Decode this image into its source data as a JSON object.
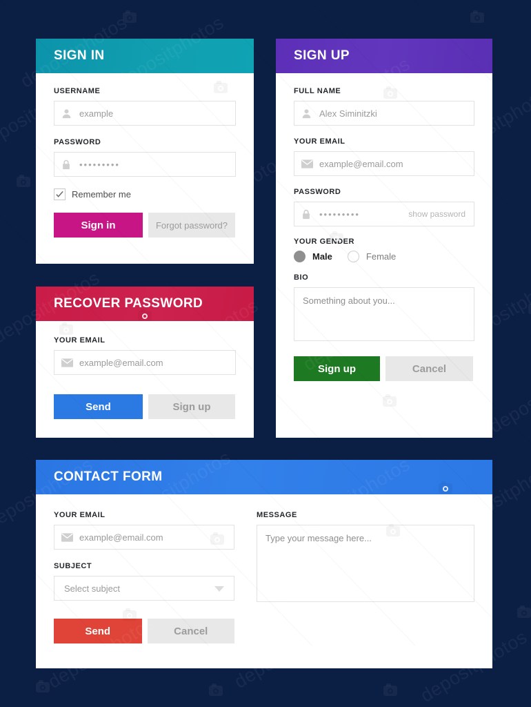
{
  "background_color": "#0b1f44",
  "watermark": {
    "text": "depositphotos",
    "icon": "camera-icon"
  },
  "cards": {
    "sign_in": {
      "title": "SIGN IN",
      "header_color": "#0d9fb3",
      "username": {
        "label": "USERNAME",
        "placeholder": "example",
        "icon": "user-icon"
      },
      "password": {
        "label": "PASSWORD",
        "value": "•••••••••",
        "icon": "lock-icon"
      },
      "remember": {
        "label": "Remember me",
        "checked": true
      },
      "primary_button": {
        "label": "Sign in",
        "color": "#c71585"
      },
      "secondary_button": {
        "label": "Forgot password?",
        "color": "#e8e8e8"
      }
    },
    "sign_up": {
      "title": "SIGN UP",
      "header_color": "#5b32b4",
      "full_name": {
        "label": "FULL NAME",
        "placeholder": "Alex Siminitzki",
        "icon": "user-icon"
      },
      "email": {
        "label": "YOUR EMAIL",
        "placeholder": "example@email.com",
        "icon": "mail-icon"
      },
      "password": {
        "label": "PASSWORD",
        "value": "•••••••••",
        "icon": "lock-icon",
        "toggle_label": "show password"
      },
      "gender": {
        "label": "YOUR GENDER",
        "options": [
          {
            "label": "Male",
            "selected": true
          },
          {
            "label": "Female",
            "selected": false
          }
        ]
      },
      "bio": {
        "label": "BIO",
        "placeholder": "Something about you..."
      },
      "primary_button": {
        "label": "Sign up",
        "color": "#1d7a23"
      },
      "secondary_button": {
        "label": "Cancel",
        "color": "#e8e8e8"
      }
    },
    "recover_password": {
      "title": "RECOVER PASSWORD",
      "header_color": "#ca1f4b",
      "email": {
        "label": "YOUR EMAIL",
        "placeholder": "example@email.com",
        "icon": "mail-icon"
      },
      "primary_button": {
        "label": "Send",
        "color": "#2b7ae4"
      },
      "secondary_button": {
        "label": "Sign up",
        "color": "#e8e8e8"
      }
    },
    "contact_form": {
      "title": "CONTACT FORM",
      "header_color": "#2b7ae4",
      "email": {
        "label": "YOUR EMAIL",
        "placeholder": "example@email.com",
        "icon": "mail-icon"
      },
      "subject": {
        "label": "SUBJECT",
        "placeholder": "Select subject",
        "icon": "chevron-down-icon"
      },
      "message": {
        "label": "MESSAGE",
        "placeholder": "Type your message here..."
      },
      "primary_button": {
        "label": "Send",
        "color": "#e04438"
      },
      "secondary_button": {
        "label": "Cancel",
        "color": "#e8e8e8"
      }
    }
  }
}
